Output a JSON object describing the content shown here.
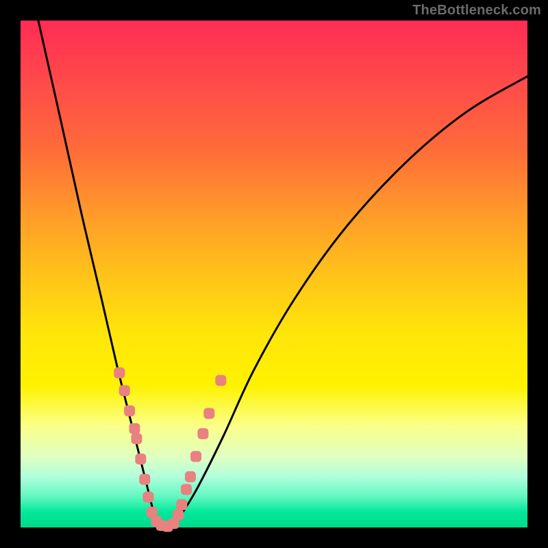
{
  "watermark": "TheBottleneck.com",
  "chart_data": {
    "type": "line",
    "title": "",
    "xlabel": "",
    "ylabel": "",
    "xlim": [
      0,
      1
    ],
    "ylim": [
      0,
      1
    ],
    "grid": false,
    "background_gradient": [
      "#ff2c54",
      "#ff6a3a",
      "#ffe60a",
      "#00d98a"
    ],
    "series": [
      {
        "name": "curve-left",
        "x": [
          0.035,
          0.08,
          0.12,
          0.16,
          0.19,
          0.215,
          0.235,
          0.25,
          0.26,
          0.27,
          0.28
        ],
        "values": [
          1.0,
          0.8,
          0.62,
          0.45,
          0.32,
          0.22,
          0.14,
          0.08,
          0.04,
          0.015,
          0.0
        ]
      },
      {
        "name": "curve-right",
        "x": [
          0.3,
          0.32,
          0.35,
          0.4,
          0.46,
          0.54,
          0.64,
          0.76,
          0.88,
          1.0
        ],
        "values": [
          0.0,
          0.03,
          0.08,
          0.18,
          0.31,
          0.45,
          0.59,
          0.72,
          0.82,
          0.89
        ]
      }
    ],
    "markers": {
      "name": "data-points",
      "color": "#e8817f",
      "shape": "rounded-square",
      "points": [
        {
          "x": 0.195,
          "y": 0.305
        },
        {
          "x": 0.205,
          "y": 0.27
        },
        {
          "x": 0.215,
          "y": 0.23
        },
        {
          "x": 0.225,
          "y": 0.195
        },
        {
          "x": 0.229,
          "y": 0.175
        },
        {
          "x": 0.237,
          "y": 0.135
        },
        {
          "x": 0.245,
          "y": 0.095
        },
        {
          "x": 0.252,
          "y": 0.06
        },
        {
          "x": 0.259,
          "y": 0.03
        },
        {
          "x": 0.268,
          "y": 0.012
        },
        {
          "x": 0.278,
          "y": 0.004
        },
        {
          "x": 0.29,
          "y": 0.002
        },
        {
          "x": 0.302,
          "y": 0.008
        },
        {
          "x": 0.311,
          "y": 0.025
        },
        {
          "x": 0.318,
          "y": 0.045
        },
        {
          "x": 0.327,
          "y": 0.075
        },
        {
          "x": 0.335,
          "y": 0.1
        },
        {
          "x": 0.346,
          "y": 0.14
        },
        {
          "x": 0.36,
          "y": 0.185
        },
        {
          "x": 0.372,
          "y": 0.225
        },
        {
          "x": 0.395,
          "y": 0.29
        }
      ]
    }
  }
}
